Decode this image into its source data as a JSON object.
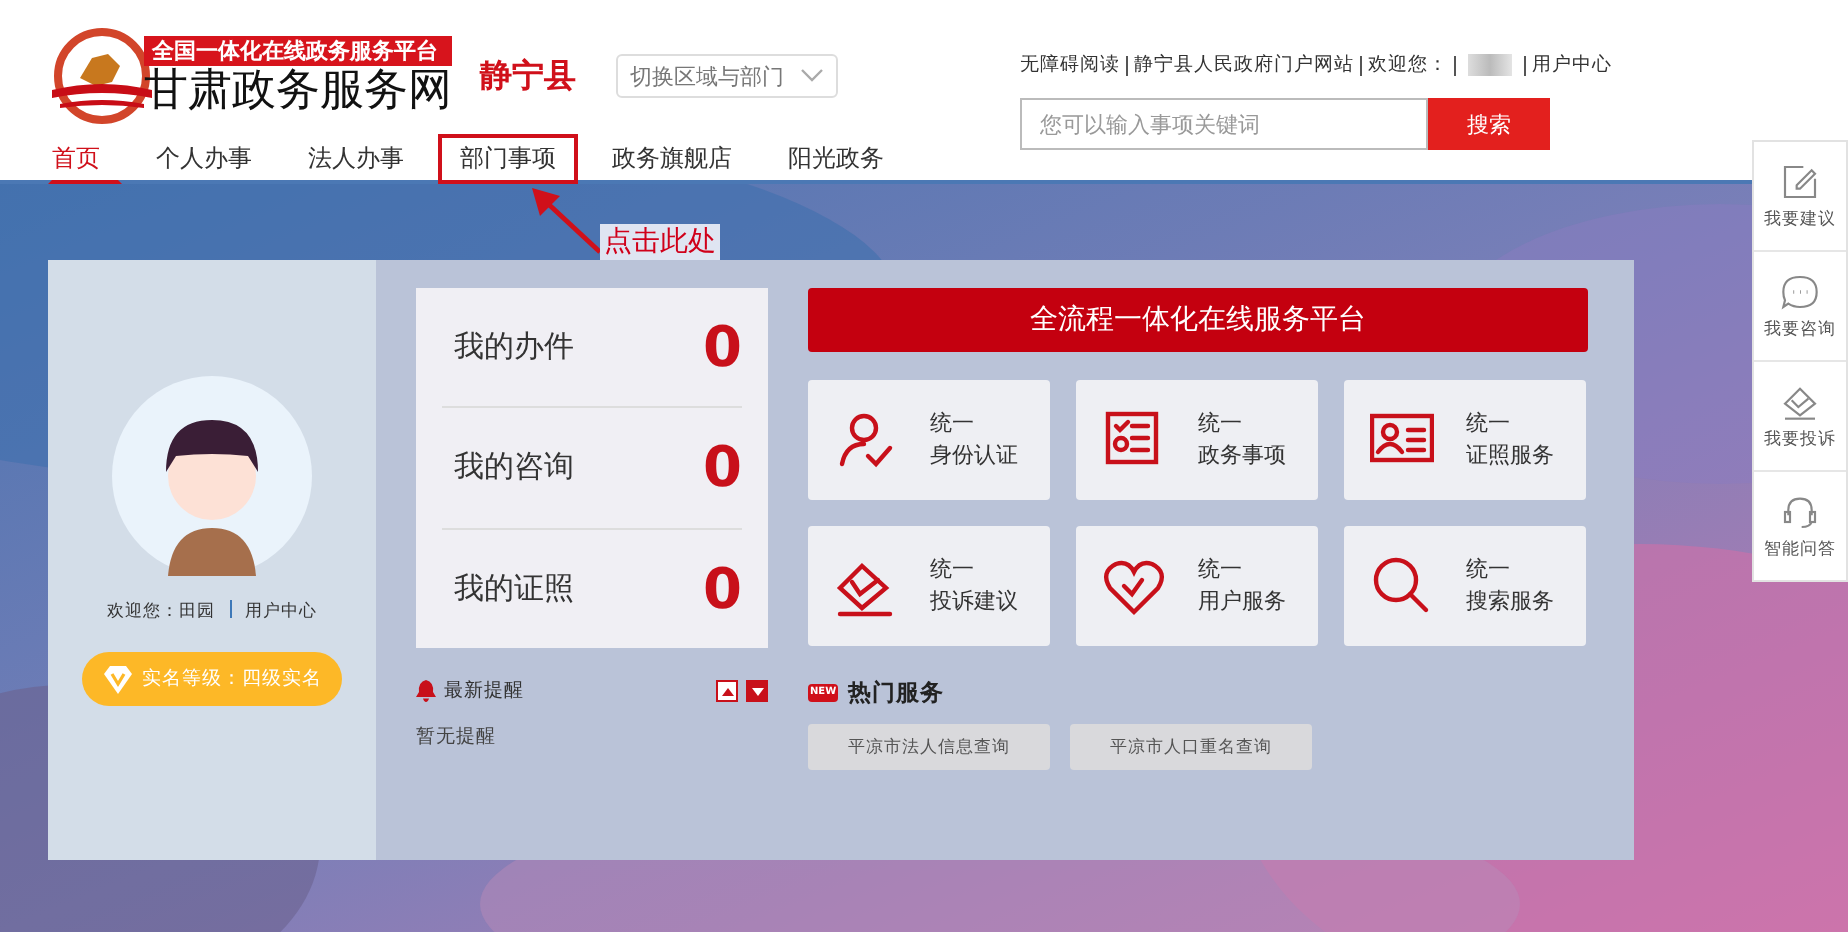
{
  "header": {
    "logo_tagline": "全国一体化在线政务服务平台",
    "logo_title": "甘肃政务服务网",
    "county": "静宁县",
    "region_select": {
      "placeholder": "切换区域与部门"
    },
    "top_links": [
      {
        "kind": "link",
        "text": "无障碍阅读"
      },
      {
        "kind": "link",
        "text": "静宁县人民政府门户网站"
      },
      {
        "kind": "text",
        "text": "欢迎您："
      },
      {
        "kind": "blurred"
      },
      {
        "kind": "link",
        "text": "用户中心"
      }
    ],
    "search": {
      "placeholder": "您可以输入事项关键词",
      "button": "搜索"
    }
  },
  "nav": [
    {
      "label": "首页",
      "selected": true,
      "highlighted": false
    },
    {
      "label": "个人办事",
      "selected": false,
      "highlighted": false
    },
    {
      "label": "法人办事",
      "selected": false,
      "highlighted": false
    },
    {
      "label": "部门事项",
      "selected": false,
      "highlighted": true
    },
    {
      "label": "政务旗舰店",
      "selected": false,
      "highlighted": false
    },
    {
      "label": "阳光政务",
      "selected": false,
      "highlighted": false
    }
  ],
  "annotation": {
    "text": "点击此处"
  },
  "user": {
    "welcome": "欢迎您：田园",
    "user_center": "用户中心",
    "level_badge": "实名等级：四级实名"
  },
  "counts": [
    {
      "label": "我的办件",
      "value": "0"
    },
    {
      "label": "我的咨询",
      "value": "0"
    },
    {
      "label": "我的证照",
      "value": "0"
    }
  ],
  "reminders": {
    "title": "最新提醒",
    "empty": "暂无提醒"
  },
  "banner": "全流程一体化在线服务平台",
  "services": [
    {
      "line1": "统一",
      "line2": "身份认证"
    },
    {
      "line1": "统一",
      "line2": "政务事项"
    },
    {
      "line1": "统一",
      "line2": "证照服务"
    },
    {
      "line1": "统一",
      "line2": "投诉建议"
    },
    {
      "line1": "统一",
      "line2": "用户服务"
    },
    {
      "line1": "统一",
      "line2": "搜索服务"
    }
  ],
  "hot_services": {
    "badge": "NEW",
    "title": "热门服务",
    "items": [
      "平凉市法人信息查询",
      "平凉市人口重名查询"
    ]
  },
  "side_tools": [
    "我要建议",
    "我要咨询",
    "我要投诉",
    "智能问答"
  ]
}
